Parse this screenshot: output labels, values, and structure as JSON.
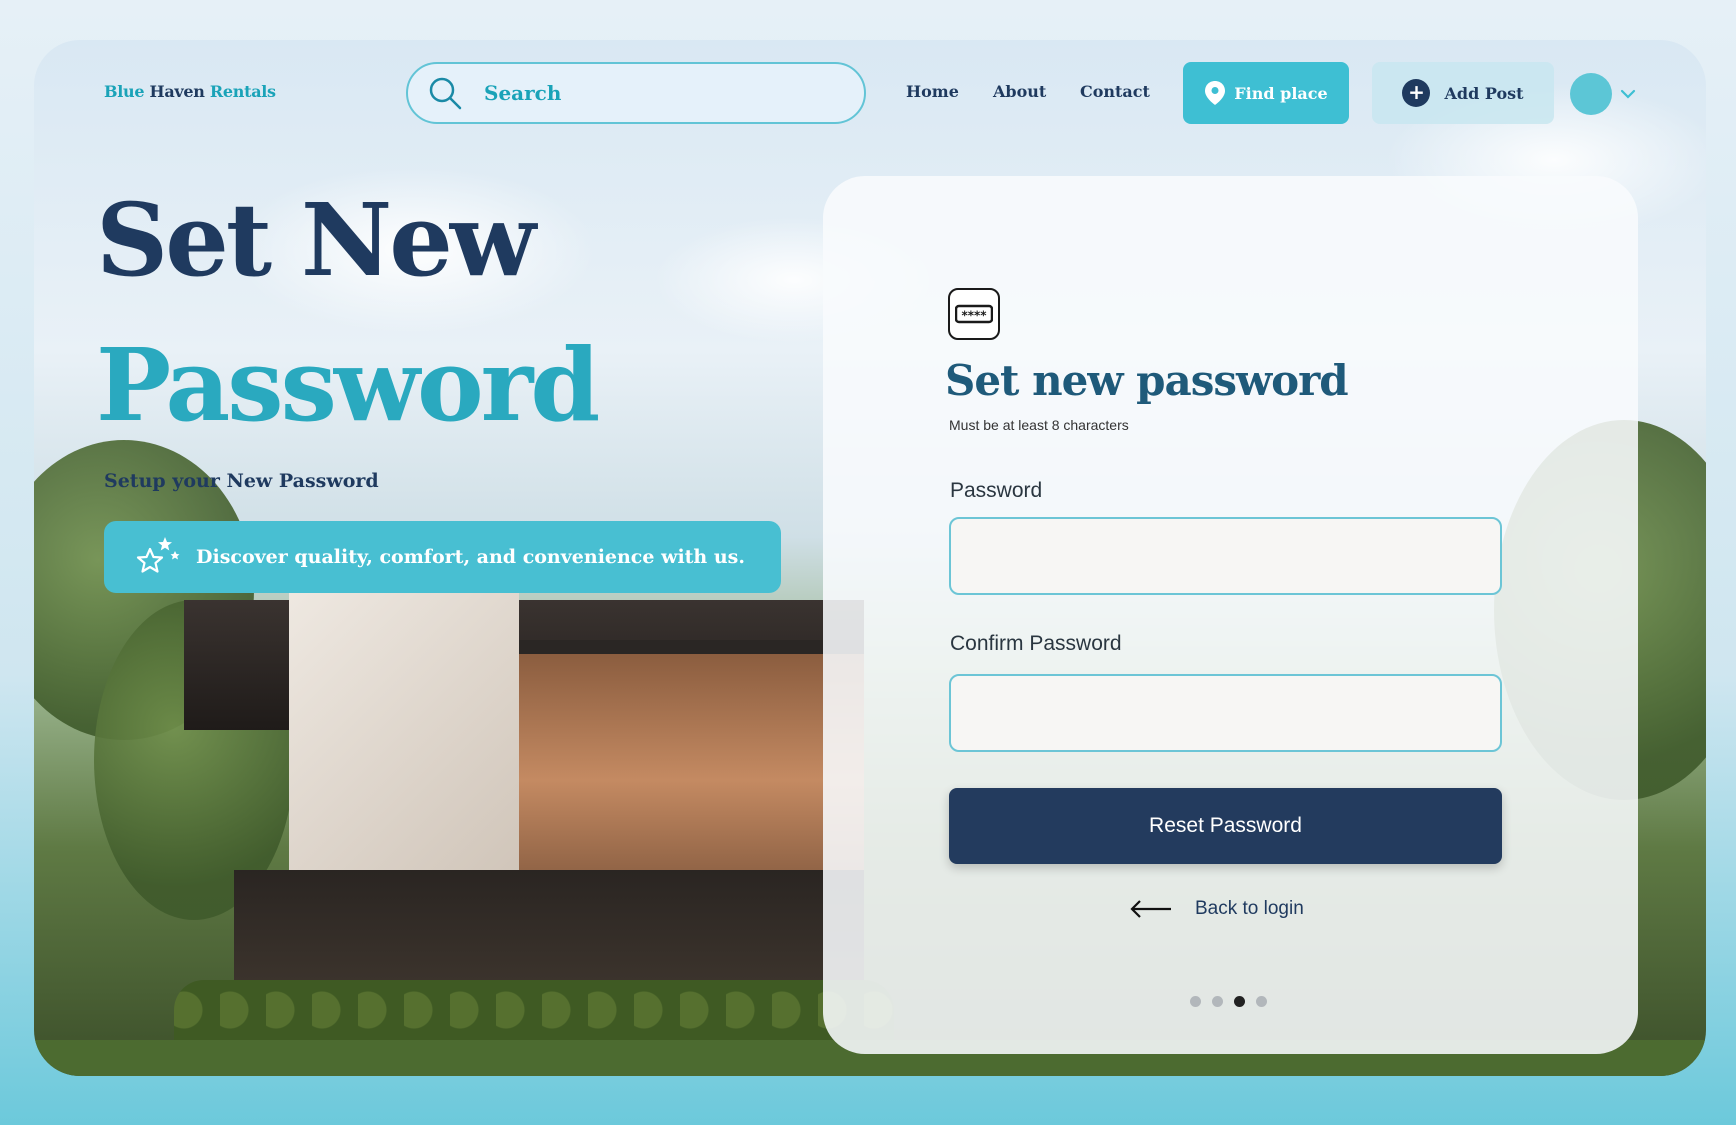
{
  "brand": {
    "part1": "Blue",
    "part2": "Haven",
    "part3": "Rentals"
  },
  "search": {
    "placeholder": "Search"
  },
  "nav": {
    "home": "Home",
    "about": "About",
    "contact": "Contact"
  },
  "actions": {
    "find_place": "Find place",
    "add_post": "Add Post"
  },
  "hero": {
    "line1": "Set New",
    "line2": "Password",
    "subtitle": "Setup your New Password",
    "banner": "Discover quality, comfort, and convenience with us."
  },
  "card": {
    "title": "Set new password",
    "subtitle": "Must be at least 8 characters",
    "password_label": "Password",
    "confirm_label": "Confirm Password",
    "submit_label": "Reset Password",
    "back_label": "Back to login",
    "pagination": {
      "total": 4,
      "active_index": 2
    }
  },
  "colors": {
    "accent": "#3ebfd3",
    "navy": "#1f3a5f",
    "button": "#233b5e"
  },
  "icons": {
    "search": "search-icon",
    "find_place": "map-pin-icon",
    "add_post": "plus-circle-icon",
    "profile_menu": "chevron-down-icon",
    "banner": "stars-icon",
    "password": "password-icon",
    "back": "arrow-left-icon"
  }
}
